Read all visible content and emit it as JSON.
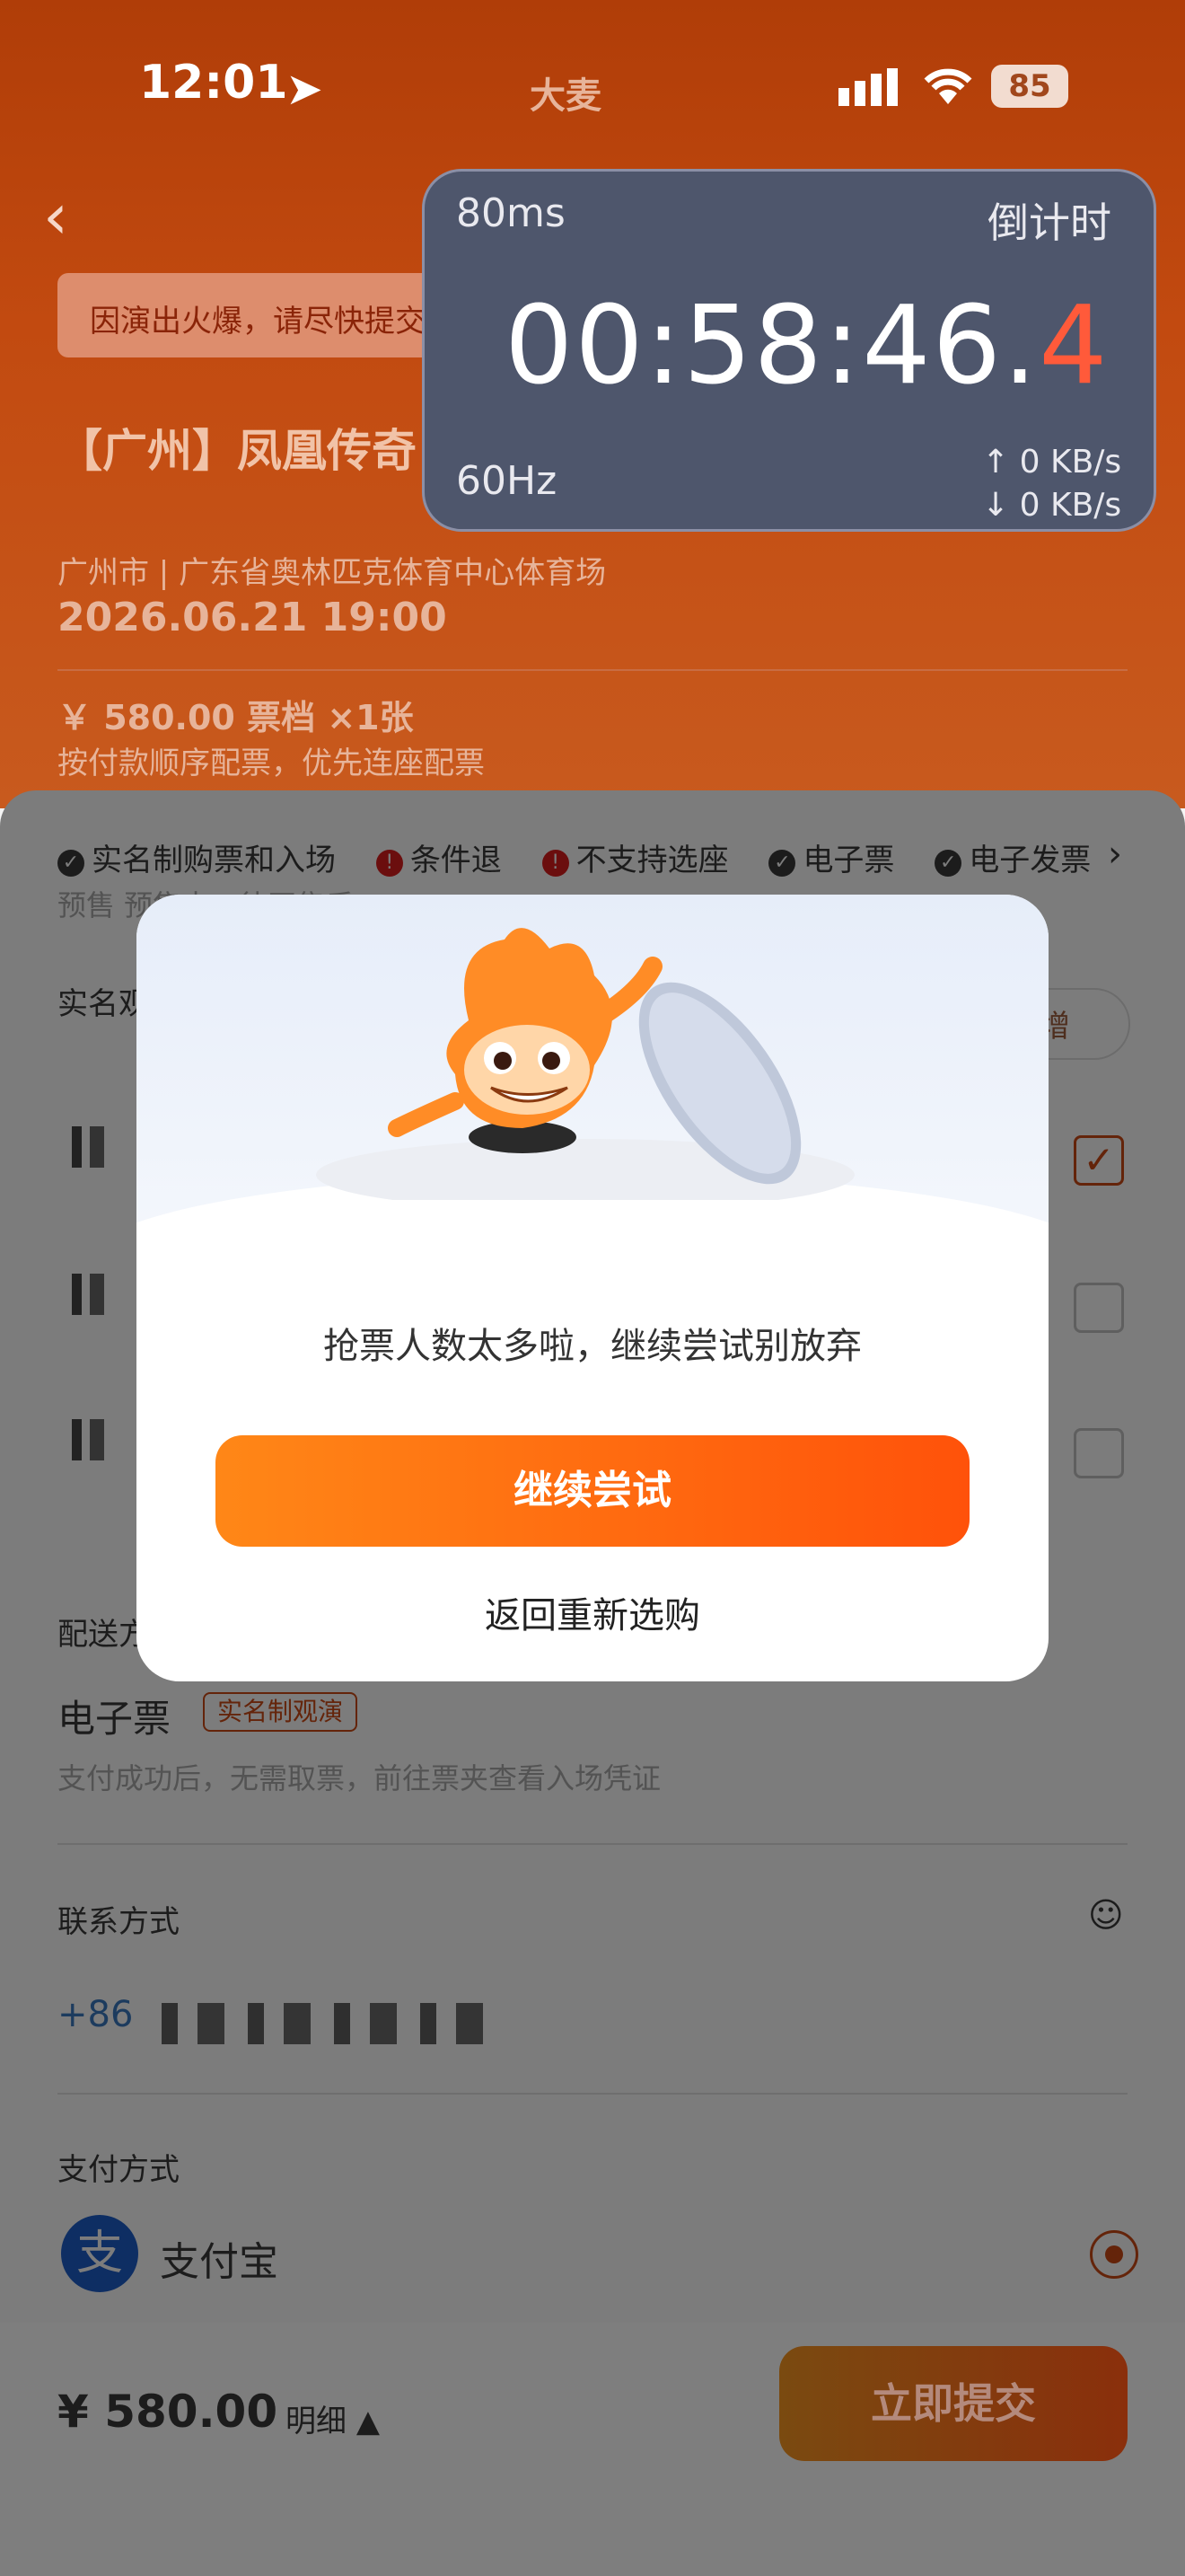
{
  "status_bar": {
    "time": "12:01",
    "brand": "大麦",
    "battery": "85"
  },
  "header": {
    "alert": "因演出火爆，请尽快提交",
    "title": "【广州】凤凰传奇 广州站",
    "venue": "广州市 | 广东省奥林匹克体育中心体育场",
    "datetime": "2026.06.21 19:00",
    "price_line": "￥ 580.00 票档 ×1张",
    "seat_note": "按付款顺序配票，优先连座配票"
  },
  "tags": [
    {
      "label": "实名制购票和入场",
      "icon": "check-circle-icon"
    },
    {
      "label": "条件退",
      "icon": "exclamation-circle-icon"
    },
    {
      "label": "不支持选座",
      "icon": "exclamation-circle-icon"
    },
    {
      "label": "电子票",
      "icon": "check-circle-icon"
    },
    {
      "label": "电子发票",
      "icon": "check-circle-icon"
    }
  ],
  "presale_text": "预售  预售中，待开售后…",
  "viewer_section": {
    "title": "实名观",
    "add_label": "增"
  },
  "delivery_section": {
    "title": "配送方",
    "type": "电子票",
    "badge": "实名制观演",
    "note": "支付成功后，无需取票，前往票夹查看入场凭证"
  },
  "contact": {
    "label": "联系方式",
    "country_code": "+86"
  },
  "payment": {
    "label": "支付方式",
    "method": "支付宝"
  },
  "bottom": {
    "total": "¥ 580.00",
    "detail": "明细",
    "submit": "立即提交"
  },
  "timer": {
    "latency": "80ms",
    "label": "倒计时",
    "clock_main": "00:58:46.",
    "clock_tenth": "4",
    "refresh": "60Hz",
    "upload": "↑ 0 KB/s",
    "download": "↓ 0 KB/s"
  },
  "modal": {
    "message": "抢票人数太多啦，继续尝试别放弃",
    "primary": "继续尝试",
    "secondary": "返回重新选购"
  }
}
